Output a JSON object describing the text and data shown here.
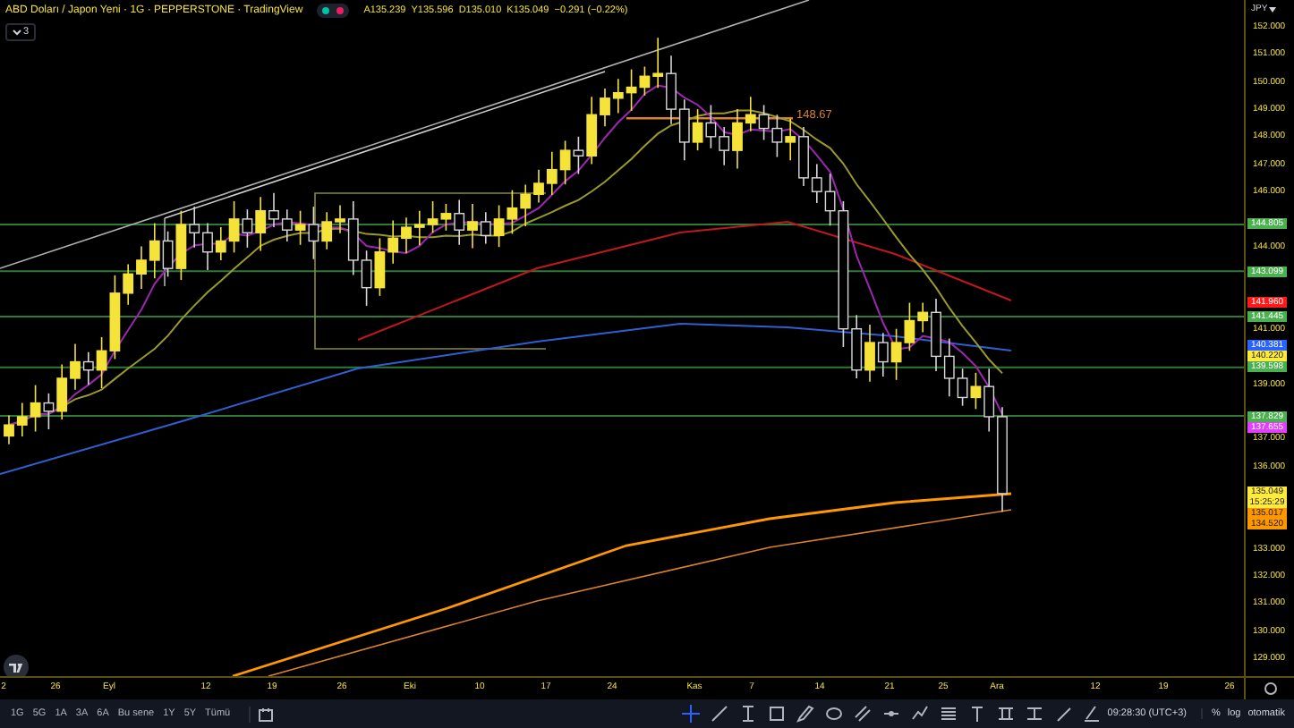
{
  "header": {
    "title": "ABD Doları / Japon Yeni · 1G · PEPPERSTONE · TradingView",
    "status_dots": [
      {
        "color": "#00bfa5"
      },
      {
        "color": "#e91e63"
      }
    ],
    "ohlc": [
      "A135.239",
      "Y135.596",
      "D135.010",
      "K135.049",
      "−0.291 (−0.22%)"
    ],
    "indicators_count": "3"
  },
  "drawing_label": "148.67",
  "price_axis": {
    "currency": "JPY",
    "ticks": [
      "152.000",
      "151.000",
      "150.000",
      "149.000",
      "148.000",
      "147.000",
      "146.000",
      "144.000",
      "141.000",
      "139.000",
      "137.000",
      "136.000",
      "133.000",
      "132.000",
      "131.000",
      "130.000",
      "129.000"
    ],
    "badges": [
      {
        "text": "144.805",
        "color": "#4caf50"
      },
      {
        "text": "143.099",
        "color": "#4caf50"
      },
      {
        "text": "141.960",
        "color": "#ff1a1a"
      },
      {
        "text": "141.445",
        "color": "#4caf50"
      },
      {
        "text": "140.381",
        "color": "#2962ff"
      },
      {
        "text": "140.220",
        "color": "#ffeb3b"
      },
      {
        "text": "139.598",
        "color": "#4caf50"
      },
      {
        "text": "137.829",
        "color": "#4caf50"
      },
      {
        "text": "137.655",
        "color": "#e040fb"
      },
      {
        "text": "135.049",
        "subtext": "15:25:29",
        "color": "#ffeb3b"
      },
      {
        "text": "135.017",
        "color": "#ff9800"
      },
      {
        "text": "134.520",
        "color": "#ff9800"
      }
    ]
  },
  "time_axis": [
    "2",
    "26",
    "Eyl",
    "12",
    "19",
    "26",
    "Eki",
    "10",
    "17",
    "24",
    "Kas",
    "7",
    "14",
    "21",
    "25",
    "Ara",
    "12",
    "19",
    "26"
  ],
  "toolbar": {
    "periods": [
      "1G",
      "5G",
      "1A",
      "3A",
      "6A",
      "Bu sene",
      "1Y",
      "5Y",
      "Tümü"
    ],
    "tools": [
      {
        "kind": "crosshair",
        "selected": true
      },
      {
        "kind": "line",
        "selected": false
      },
      {
        "kind": "ibeam",
        "selected": false
      },
      {
        "kind": "rect",
        "selected": false
      },
      {
        "kind": "brush",
        "selected": false
      },
      {
        "kind": "ellipse",
        "selected": false
      },
      {
        "kind": "channel",
        "selected": false
      },
      {
        "kind": "hline",
        "selected": false
      },
      {
        "kind": "zigzag",
        "selected": false
      },
      {
        "kind": "lines",
        "selected": false
      },
      {
        "kind": "text",
        "selected": false
      },
      {
        "kind": "ruler",
        "selected": false
      },
      {
        "kind": "range",
        "selected": false
      },
      {
        "kind": "pen",
        "selected": false
      },
      {
        "kind": "eraser",
        "selected": false
      }
    ],
    "clock": "09:28:30 (UTC+3)",
    "scale_buttons": [
      "%",
      "log",
      "otomatik"
    ]
  }
}
